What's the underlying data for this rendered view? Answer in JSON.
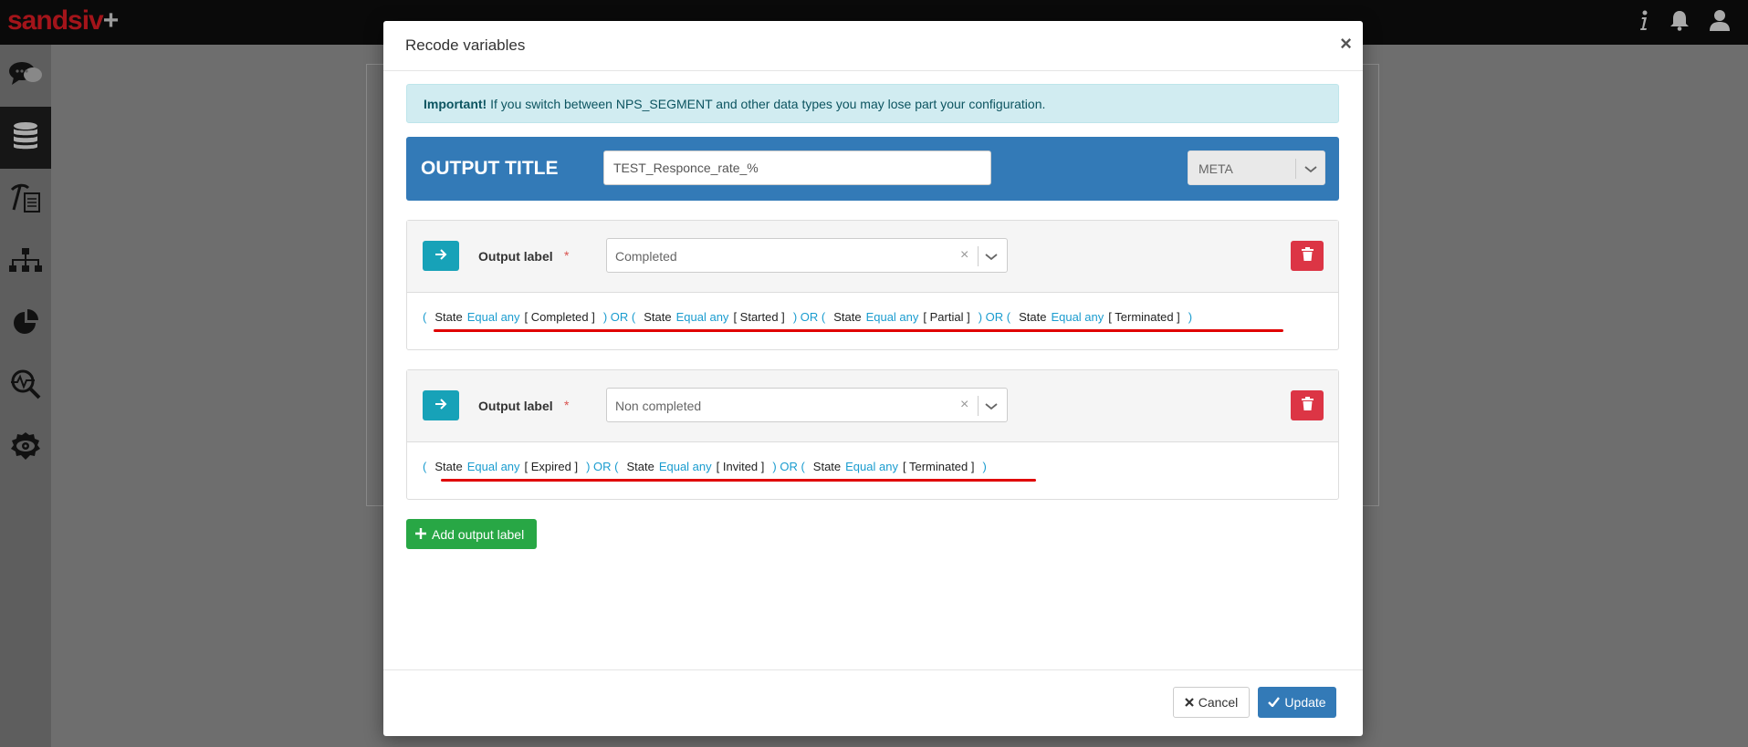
{
  "app": {
    "logo_text": "sandsiv",
    "logo_plus": "+"
  },
  "topbar": {
    "icons": [
      "info-icon",
      "bell-icon",
      "user-icon"
    ]
  },
  "sidebar": {
    "items": [
      {
        "icon": "chat-bubbles-icon",
        "active": false
      },
      {
        "icon": "database-icon",
        "active": true
      },
      {
        "icon": "mining-tool-icon",
        "active": false
      },
      {
        "icon": "hierarchy-icon",
        "active": false
      },
      {
        "icon": "pie-chart-icon",
        "active": false
      },
      {
        "icon": "analytics-search-icon",
        "active": false
      },
      {
        "icon": "eye-gear-icon",
        "active": false
      }
    ]
  },
  "modal": {
    "title": "Recode variables",
    "close": "×",
    "alert": {
      "strong": "Important!",
      "text": " If you switch between NPS_SEGMENT and other data types you may lose part your configuration."
    },
    "output_title": {
      "label": "OUTPUT TITLE",
      "value": "TEST_Responce_rate_%",
      "type_value": "META"
    },
    "output_labels": [
      {
        "label": "Output label",
        "required": "*",
        "value": "Completed",
        "clear": "×",
        "conditions": [
          {
            "field": "State",
            "operator": "Equal any",
            "values": "[ Completed ]"
          },
          {
            "field": "State",
            "operator": "Equal any",
            "values": "[ Started ]"
          },
          {
            "field": "State",
            "operator": "Equal any",
            "values": "[ Partial ]"
          },
          {
            "field": "State",
            "operator": "Equal any",
            "values": "[ Terminated ]"
          }
        ]
      },
      {
        "label": "Output label",
        "required": "*",
        "value": "Non completed",
        "clear": "×",
        "conditions": [
          {
            "field": "State",
            "operator": "Equal any",
            "values": "[ Expired ]"
          },
          {
            "field": "State",
            "operator": "Equal any",
            "values": "[ Invited ]"
          },
          {
            "field": "State",
            "operator": "Equal any",
            "values": "[ Terminated ]"
          }
        ]
      }
    ],
    "expr_tokens": {
      "open": "(",
      "close": ")",
      "or": ") OR ("
    },
    "add_button": "Add output label",
    "footer": {
      "cancel": "Cancel",
      "update": "Update"
    }
  },
  "colors": {
    "brand": "#a3141a",
    "primary": "#337ab7",
    "info": "#17a2b8",
    "danger": "#dc3545",
    "success": "#28a745",
    "operator": "#1a9ccf",
    "annotation": "#e00000"
  }
}
